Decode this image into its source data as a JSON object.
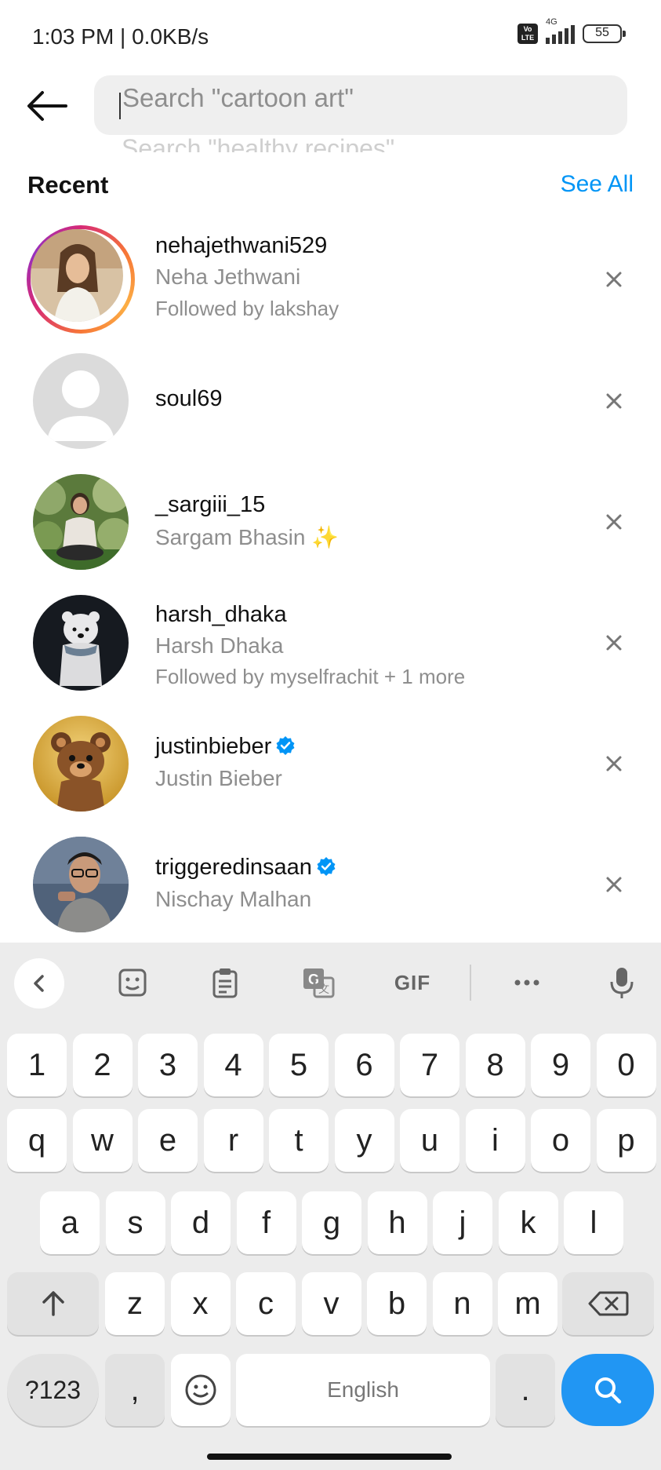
{
  "status_bar": {
    "time": "1:03 PM | 0.0KB/s",
    "volte": "Vo LTE",
    "network": "4G",
    "battery": "55"
  },
  "search": {
    "placeholder": "Search \"cartoon art\"",
    "next_placeholder": "Search \"healthy recipes\""
  },
  "recent": {
    "heading": "Recent",
    "see_all": "See All"
  },
  "accounts": [
    {
      "username": "nehajethwani529",
      "name": "Neha Jethwani",
      "followed_by": "Followed by lakshay",
      "story_ring": true,
      "verified": false
    },
    {
      "username": "soul69",
      "name": "",
      "followed_by": "",
      "story_ring": false,
      "verified": false
    },
    {
      "username": "_sargiii_15",
      "name": "Sargam Bhasin ✨",
      "followed_by": "",
      "story_ring": false,
      "verified": false
    },
    {
      "username": "harsh_dhaka",
      "name": "Harsh Dhaka",
      "followed_by": "Followed by myselfrachit + 1 more",
      "story_ring": false,
      "verified": false
    },
    {
      "username": "justinbieber",
      "name": "Justin Bieber",
      "followed_by": "",
      "story_ring": false,
      "verified": true
    },
    {
      "username": "triggeredinsaan",
      "name": "Nischay Malhan",
      "followed_by": "",
      "story_ring": false,
      "verified": true
    }
  ],
  "keyboard": {
    "toolbar": [
      "chevron-left-icon",
      "sticker-icon",
      "clipboard-icon",
      "translate-icon",
      "GIF",
      "more-icon",
      "mic-icon"
    ],
    "gif_label": "GIF",
    "row_numbers": [
      "1",
      "2",
      "3",
      "4",
      "5",
      "6",
      "7",
      "8",
      "9",
      "0"
    ],
    "row_top": [
      "q",
      "w",
      "e",
      "r",
      "t",
      "y",
      "u",
      "i",
      "o",
      "p"
    ],
    "row_mid": [
      "a",
      "s",
      "d",
      "f",
      "g",
      "h",
      "j",
      "k",
      "l"
    ],
    "row_bottom": [
      "z",
      "x",
      "c",
      "v",
      "b",
      "n",
      "m"
    ],
    "symbols_label": "?123",
    "comma": ",",
    "space_label": "English",
    "period": "."
  },
  "colors": {
    "accent": "#0095f6",
    "search_key": "#2196f3",
    "verified": "#0095f6"
  }
}
